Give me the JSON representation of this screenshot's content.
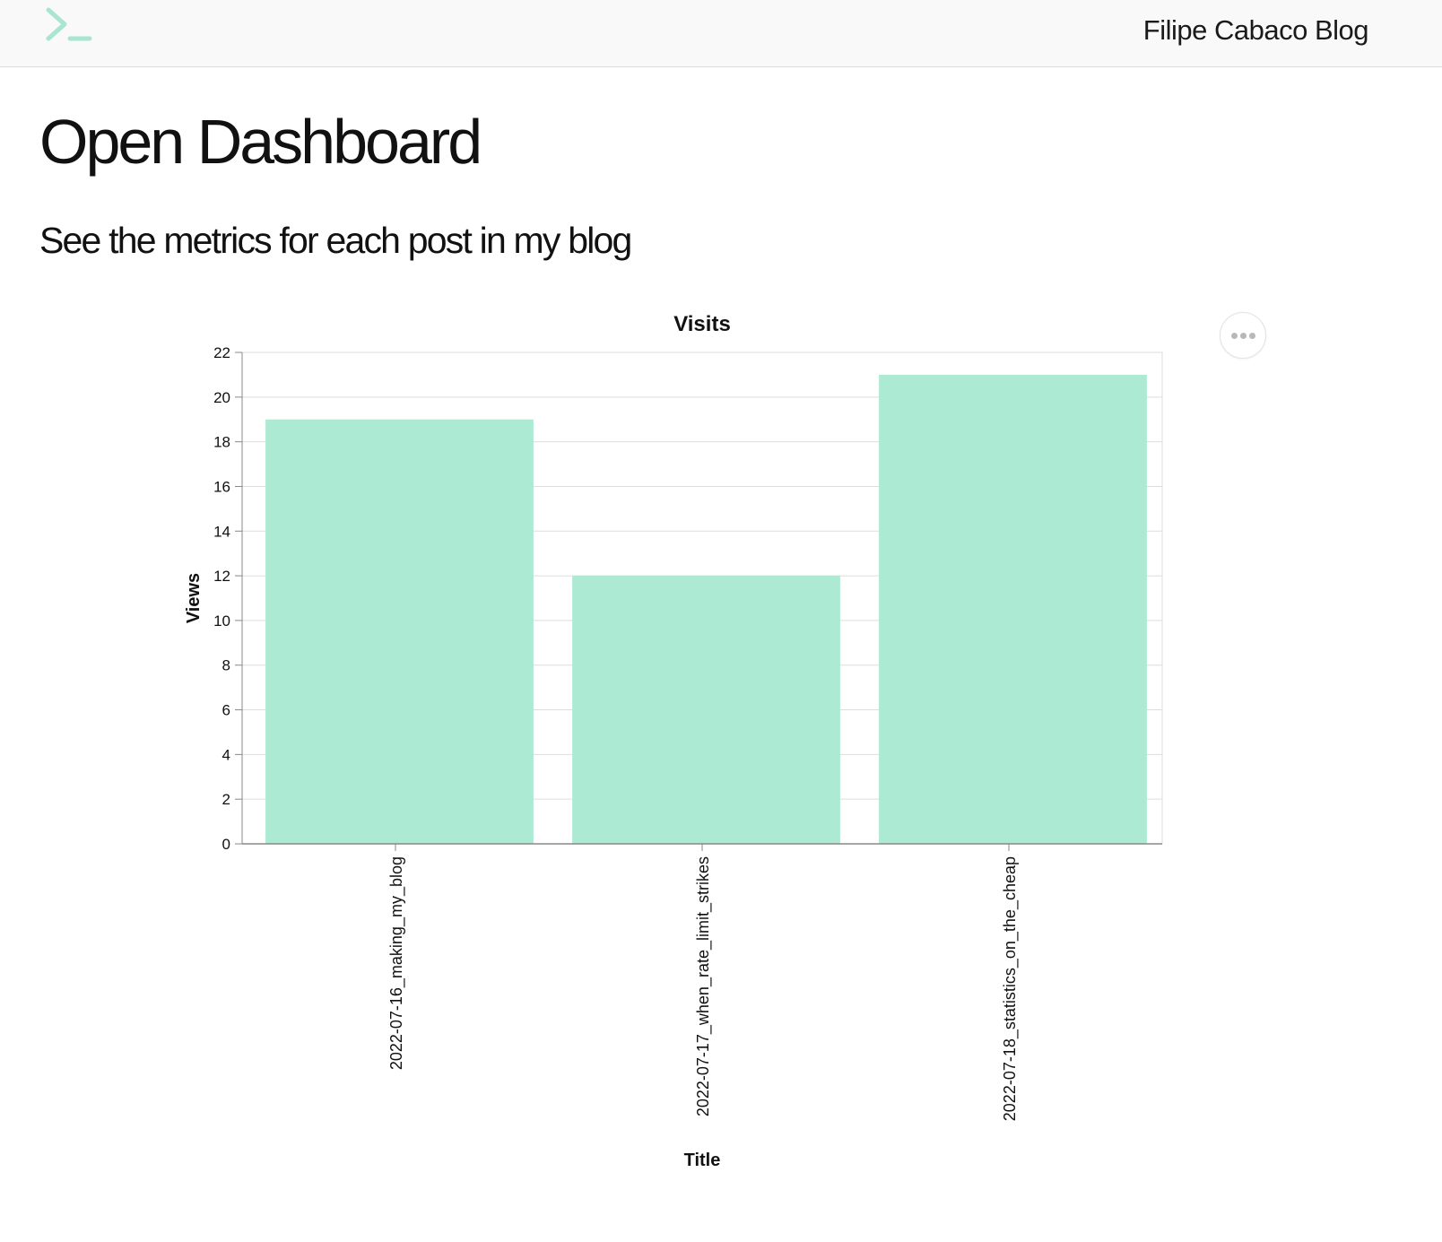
{
  "header": {
    "logo_icon": "terminal-prompt-icon",
    "site_title": "Filipe Cabaco Blog",
    "accent_color": "#a8e6d2"
  },
  "main": {
    "title": "Open Dashboard",
    "subtitle": "See the metrics for each post in my blog"
  },
  "chart_actions": {
    "icon": "ellipsis-icon"
  },
  "chart_data": {
    "type": "bar",
    "title": "Visits",
    "xlabel": "Title",
    "ylabel": "Views",
    "categories": [
      "2022-07-16_making_my_blog",
      "2022-07-17_when_rate_limit_strikes",
      "2022-07-18_statistics_on_the_cheap"
    ],
    "values": [
      19,
      12,
      21
    ],
    "ylim": [
      0,
      22
    ],
    "yticks": [
      0,
      2,
      4,
      6,
      8,
      10,
      12,
      14,
      16,
      18,
      20,
      22
    ],
    "grid": true,
    "bar_color": "#acead4"
  }
}
